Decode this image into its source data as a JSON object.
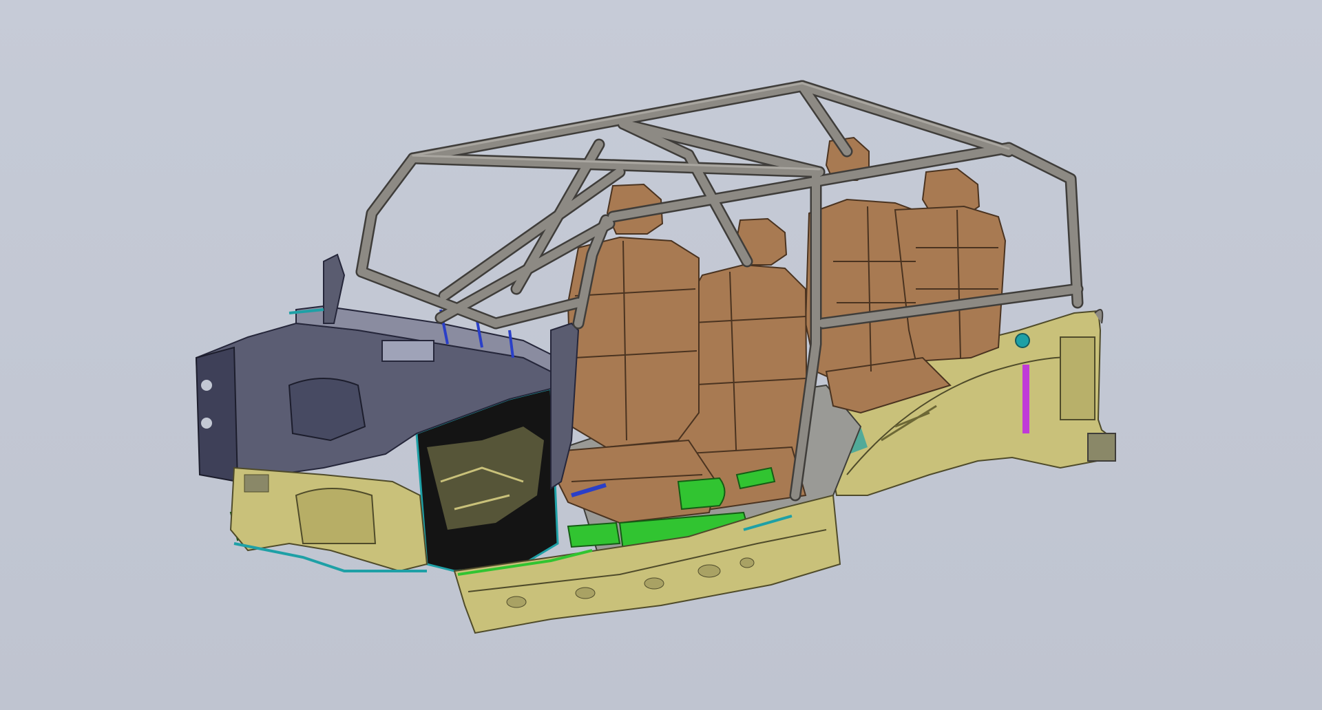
{
  "scene": {
    "subject": "cad-vehicle-body-assembly",
    "parts": [
      "roll-cage",
      "front-seats",
      "rear-seats",
      "dash-panel",
      "firewall",
      "floor-pan",
      "rocker-panel",
      "rear-wheelhouse",
      "seat-rails"
    ]
  },
  "colors": {
    "background": "#c3c8d4",
    "roll_cage": "#8d8a84",
    "roll_cage_edge": "#3f3d3a",
    "seat": "#a87a52",
    "seat_edge": "#4a3320",
    "panel": "#c9c17a",
    "panel_edge": "#4f4b2a",
    "dash": "#5b5d73",
    "firewall_dark": "#141414",
    "seat_rail": "#31c431",
    "accent_teal": "#1ea0a6",
    "accent_magenta": "#c03ad8",
    "accent_blue": "#2a3fc8"
  }
}
